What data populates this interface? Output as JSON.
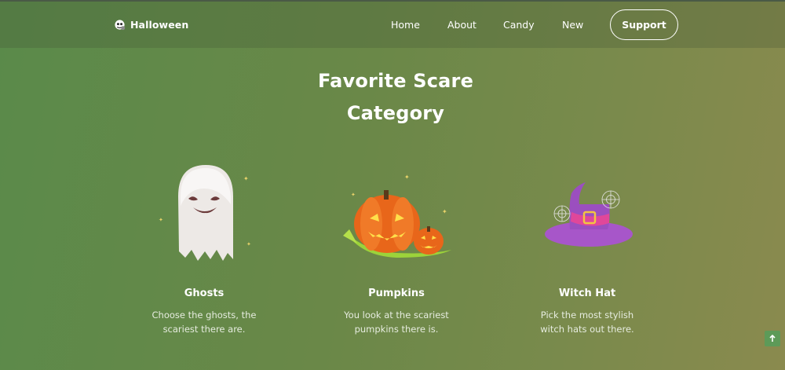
{
  "header": {
    "brand": "Halloween",
    "nav": [
      "Home",
      "About",
      "Candy",
      "New"
    ],
    "support_label": "Support"
  },
  "section": {
    "title_line1": "Favorite Scare",
    "title_line2": "Category"
  },
  "cards": [
    {
      "title": "Ghosts",
      "desc_line1": "Choose the ghosts, the",
      "desc_line2": "scariest there are.",
      "icon": "ghost-image"
    },
    {
      "title": "Pumpkins",
      "desc_line1": "You look at the scariest",
      "desc_line2": "pumpkins there is.",
      "icon": "pumpkin-image"
    },
    {
      "title": "Witch Hat",
      "desc_line1": "Pick the most stylish",
      "desc_line2": "witch hats out there.",
      "icon": "witch-hat-image"
    }
  ],
  "colors": {
    "background_start": "#5a8a4a",
    "background_end": "#8a8a4e",
    "scroll_top_button": "#5d9a58"
  }
}
